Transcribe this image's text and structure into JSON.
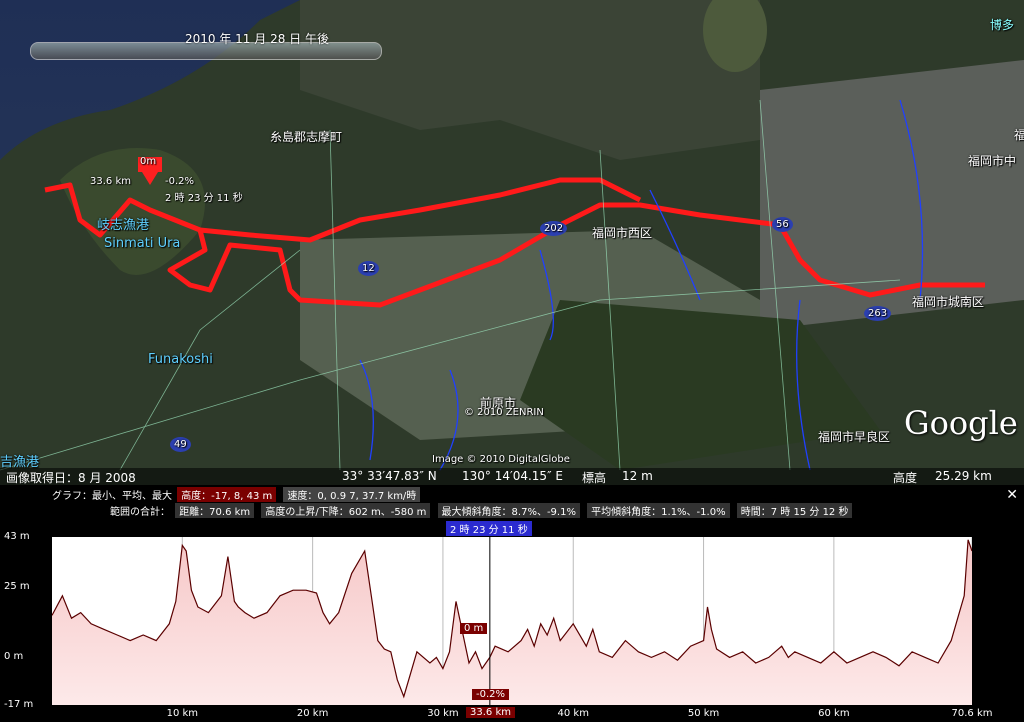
{
  "map": {
    "time_label": "2010 年 11 月 28 日    午後",
    "place_labels": [
      {
        "text": "糸島郡志摩町",
        "cls": ""
      },
      {
        "text": "岐志漁港",
        "cls": "blue"
      },
      {
        "text": "Sinmati Ura",
        "cls": "blue"
      },
      {
        "text": "Funakoshi",
        "cls": "blue"
      },
      {
        "text": "吉漁港",
        "cls": "blue"
      },
      {
        "text": "福岡市西区",
        "cls": ""
      },
      {
        "text": "福岡市城南区",
        "cls": ""
      },
      {
        "text": "福岡市早良区",
        "cls": ""
      },
      {
        "text": "前原市",
        "cls": ""
      },
      {
        "text": "博多",
        "cls": "cyan"
      },
      {
        "text": "福岡市中",
        "cls": ""
      },
      {
        "text": "福",
        "cls": ""
      }
    ],
    "route_badges": [
      "202",
      "12",
      "56",
      "263",
      "49"
    ],
    "marker": {
      "elev": "0m",
      "dist": "33.6 km",
      "grade": "-0.2%",
      "time": "2 時 23 分 11 秒"
    },
    "copyright_zenrin": "© 2010 ZENRIN",
    "copyright_imagery": "Image © 2010 DigitalGlobe",
    "google_logo": "Google"
  },
  "status": {
    "acq_date": "画像取得日：8 月 2008",
    "lat": "33° 33′47.83″ N",
    "lon": "130° 14′04.15″ E",
    "elev_label": "標高",
    "elev_value": "12 m",
    "alt_label": "高度",
    "alt_value": "25.29 km"
  },
  "panel": {
    "graph_label": "グラフ：最小、平均、最大",
    "elev_stat": "高度：-17, 8, 43 m",
    "speed_stat": "速度：0, 0.9 7, 37.7 km/時",
    "range_label": "範囲の合計：",
    "distance": "距離：70.6 km",
    "updown": "高度の上昇/下降：602 m、-580 m",
    "max_slope": "最大傾斜角度：8.7%、-9.1%",
    "avg_slope": "平均傾斜角度：1.1%、-1.0%",
    "duration": "時間：7 時 15 分 12 秒",
    "selected_time": "2 時 23 分 11 秒",
    "close_icon": "close-icon",
    "cursor_elev": "0 m",
    "cursor_grade": "-0.2%",
    "cursor_x": "33.6 km"
  },
  "chart_data": {
    "type": "area",
    "xlabel": "",
    "ylabel": "",
    "xlim": [
      0,
      70.6
    ],
    "ylim": [
      -17,
      43
    ],
    "y_ticks": [
      "43 m",
      "25 m",
      "0 m",
      "-17 m"
    ],
    "y_tick_values": [
      43,
      25,
      0,
      -17
    ],
    "x_ticks": [
      "10 km",
      "20 km",
      "30 km",
      "40 km",
      "50 km",
      "60 km",
      "70.6 km"
    ],
    "x_tick_values": [
      10,
      20,
      30,
      40,
      50,
      60,
      70.6
    ],
    "cursor_x": 33.6,
    "fill_color": "#f6c8c8",
    "line_color": "#5a0000",
    "series": [
      {
        "x": [
          0,
          0.8,
          1.5,
          2.2,
          3,
          4,
          5,
          6,
          7,
          8,
          9,
          9.5,
          10,
          10.3,
          10.7,
          11.2,
          12,
          13,
          13.5,
          14,
          14.3,
          14.8,
          15.5,
          16.5,
          17.5,
          18.5,
          19.5,
          20.3,
          20.8,
          21.3,
          22,
          23,
          24,
          24.5,
          25,
          25.5,
          26,
          26.5,
          27,
          28,
          29,
          29.5,
          30,
          30.5,
          31,
          32,
          32.5,
          33,
          33.6,
          34,
          35,
          36,
          36.5,
          37,
          37.5,
          38,
          38.5,
          39,
          40,
          41,
          41.5,
          42,
          43,
          44,
          45,
          46,
          47,
          48,
          49,
          50,
          50.3,
          50.6,
          51,
          52,
          53,
          54,
          55,
          56,
          56.5,
          57,
          58,
          59,
          60,
          61,
          62,
          63,
          64,
          65,
          66,
          67,
          68,
          69,
          69.5,
          70,
          70.3,
          70.6
        ],
        "y": [
          15,
          22,
          14,
          16,
          12,
          10,
          8,
          6,
          8,
          6,
          12,
          20,
          40,
          38,
          24,
          18,
          16,
          22,
          36,
          20,
          18,
          16,
          14,
          16,
          22,
          24,
          24,
          23,
          16,
          12,
          16,
          30,
          38,
          22,
          6,
          3,
          2,
          -8,
          -14,
          2,
          -2,
          0,
          -4,
          2,
          20,
          -2,
          2,
          -4,
          0,
          4,
          2,
          6,
          10,
          4,
          12,
          8,
          14,
          6,
          12,
          4,
          10,
          2,
          0,
          6,
          2,
          0,
          2,
          -1,
          4,
          6,
          18,
          10,
          3,
          0,
          2,
          -2,
          0,
          4,
          0,
          2,
          0,
          -2,
          2,
          -2,
          0,
          2,
          0,
          -3,
          2,
          0,
          -2,
          6,
          14,
          22,
          42,
          38
        ]
      }
    ]
  }
}
